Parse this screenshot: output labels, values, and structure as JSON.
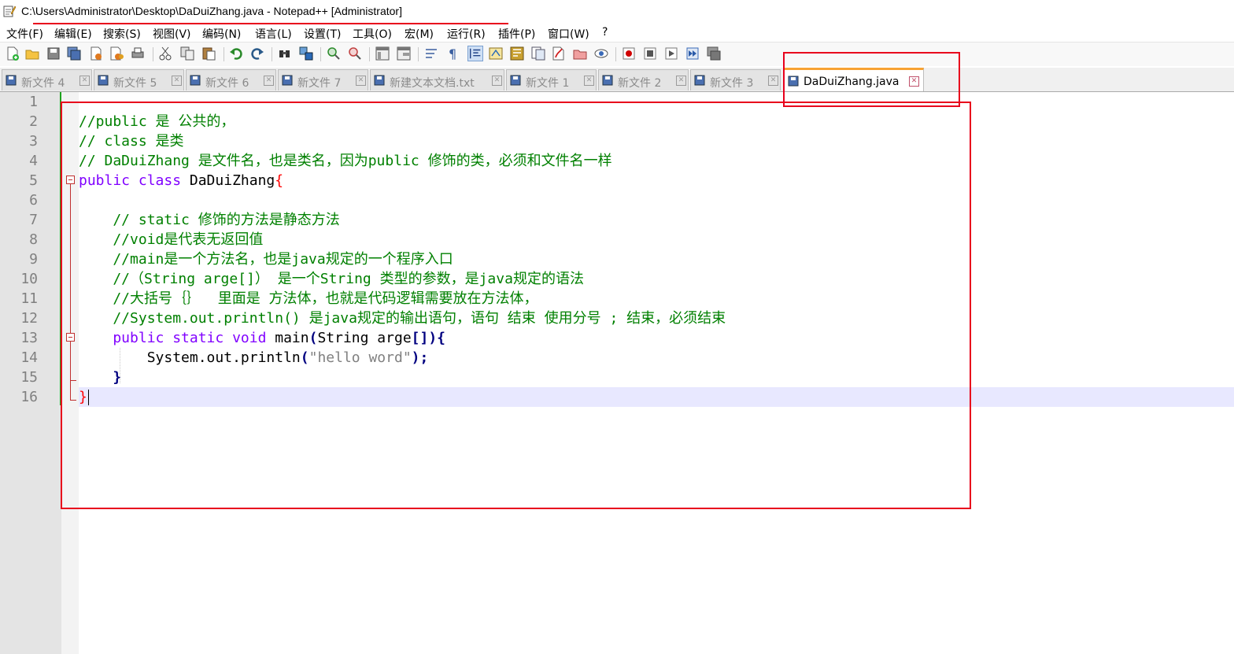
{
  "window": {
    "title": "C:\\Users\\Administrator\\Desktop\\DaDuiZhang.java - Notepad++ [Administrator]",
    "app_icon": "notepad-icon"
  },
  "menu": [
    "文件(F)",
    "编辑(E)",
    "搜索(S)",
    "视图(V)",
    "编码(N)",
    "语言(L)",
    "设置(T)",
    "工具(O)",
    "宏(M)",
    "运行(R)",
    "插件(P)",
    "窗口(W)",
    "?"
  ],
  "toolbar": {
    "icons": [
      "new-file-icon",
      "open-file-icon",
      "save-icon",
      "save-all-icon",
      "close-icon",
      "close-all-icon",
      "print-icon",
      "cut-icon",
      "copy-icon",
      "paste-icon",
      "undo-icon",
      "redo-icon",
      "find-icon",
      "replace-icon",
      "zoom-in-icon",
      "zoom-out-icon",
      "sync-vertical-icon",
      "sync-horizontal-icon",
      "word-wrap-icon",
      "show-all-chars-icon",
      "indent-guide-icon",
      "user-language-icon",
      "doc-map-icon",
      "function-list-icon",
      "folder-as-workspace-icon",
      "monitoring-icon",
      "record-macro-icon",
      "stop-record-icon",
      "play-macro-icon",
      "run-macro-multiple-icon",
      "save-macro-icon"
    ]
  },
  "tabs": [
    {
      "label": "新文件 4",
      "active": false
    },
    {
      "label": "新文件 5",
      "active": false
    },
    {
      "label": "新文件 6",
      "active": false
    },
    {
      "label": "新文件 7",
      "active": false
    },
    {
      "label": "新建文本文档.txt",
      "active": false
    },
    {
      "label": "新文件 1",
      "active": false
    },
    {
      "label": "新文件 2",
      "active": false
    },
    {
      "label": "新文件 3",
      "active": false
    },
    {
      "label": "DaDuiZhang.java",
      "active": true
    }
  ],
  "editor": {
    "line_numbers": [
      "1",
      "2",
      "3",
      "4",
      "5",
      "6",
      "7",
      "8",
      "9",
      "10",
      "11",
      "12",
      "13",
      "14",
      "15",
      "16"
    ],
    "lines": [
      [],
      [
        {
          "t": "//public 是 公共的，",
          "c": "comment"
        }
      ],
      [
        {
          "t": "// class 是类",
          "c": "comment"
        }
      ],
      [
        {
          "t": "// DaDuiZhang 是文件名，也是类名，因为public 修饰的类，必须和文件名一样",
          "c": "comment"
        }
      ],
      [
        {
          "t": "public class",
          "c": "kw"
        },
        {
          "t": " DaDuiZhang",
          "c": "plain"
        },
        {
          "t": "{",
          "c": "red"
        }
      ],
      [],
      [
        {
          "t": "    // static 修饰的方法是静态方法",
          "c": "comment"
        }
      ],
      [
        {
          "t": "    //void是代表无返回值",
          "c": "comment"
        }
      ],
      [
        {
          "t": "    //main是一个方法名，也是java规定的一个程序入口",
          "c": "comment"
        }
      ],
      [
        {
          "t": "    //（String arge[]） 是一个String 类型的参数，是java规定的语法",
          "c": "comment"
        }
      ],
      [
        {
          "t": "    //大括号｛｝  里面是 方法体，也就是代码逻辑需要放在方法体，",
          "c": "comment"
        }
      ],
      [
        {
          "t": "    //System.out.println() 是java规定的输出语句，语句 结束 使用分号 ; 结束，必须结束",
          "c": "comment"
        }
      ],
      [
        {
          "t": "    public static void",
          "c": "kw"
        },
        {
          "t": " main",
          "c": "plain"
        },
        {
          "t": "(",
          "c": "op"
        },
        {
          "t": "String arge",
          "c": "plain"
        },
        {
          "t": "[]){",
          "c": "op"
        }
      ],
      [
        {
          "t": "        System.out.println",
          "c": "plain"
        },
        {
          "t": "(",
          "c": "op"
        },
        {
          "t": "\"hello word\"",
          "c": "str"
        },
        {
          "t": ");",
          "c": "op"
        }
      ],
      [
        {
          "t": "    ",
          "c": "plain"
        },
        {
          "t": "}",
          "c": "op"
        }
      ],
      [
        {
          "t": "}",
          "c": "red"
        }
      ]
    ]
  },
  "colors": {
    "comment": "#008000",
    "keyword": "#8000ff",
    "operator": "#000080",
    "string": "#808080",
    "brace_highlight": "#ff0000",
    "annotation_red": "#e8001c",
    "active_tab_accent": "#f7a233"
  }
}
